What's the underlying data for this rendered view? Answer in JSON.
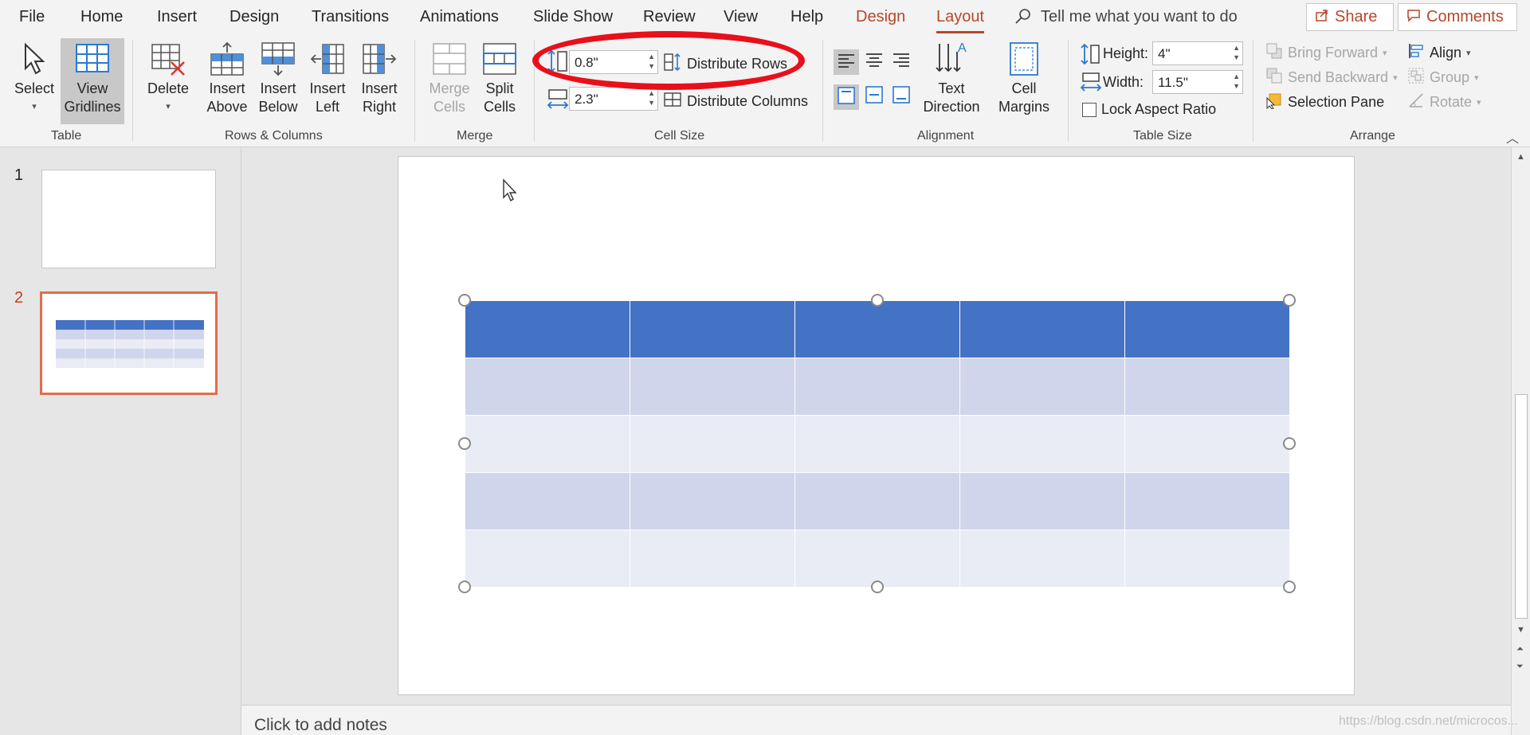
{
  "tabs": {
    "file": "File",
    "home": "Home",
    "insert": "Insert",
    "design": "Design",
    "transitions": "Transitions",
    "animations": "Animations",
    "slide_show": "Slide Show",
    "review": "Review",
    "view": "View",
    "help": "Help",
    "table_design": "Design",
    "table_layout": "Layout"
  },
  "search": {
    "label": "Tell me what you want to do"
  },
  "share": "Share",
  "comments": "Comments",
  "ribbon": {
    "table": {
      "select": "Select",
      "view_gridlines_1": "View",
      "view_gridlines_2": "Gridlines",
      "group": "Table"
    },
    "rows_cols": {
      "delete": "Delete",
      "insert_above_1": "Insert",
      "insert_above_2": "Above",
      "insert_below_1": "Insert",
      "insert_below_2": "Below",
      "insert_left_1": "Insert",
      "insert_left_2": "Left",
      "insert_right_1": "Insert",
      "insert_right_2": "Right",
      "group": "Rows & Columns"
    },
    "merge": {
      "merge_1": "Merge",
      "merge_2": "Cells",
      "split_1": "Split",
      "split_2": "Cells",
      "group": "Merge"
    },
    "cell_size": {
      "row_height": "0.8\"",
      "col_width": "2.3\"",
      "distribute_rows": "Distribute Rows",
      "distribute_columns": "Distribute Columns",
      "group": "Cell Size"
    },
    "alignment": {
      "text_dir_1": "Text",
      "text_dir_2": "Direction",
      "margins_1": "Cell",
      "margins_2": "Margins",
      "group": "Alignment"
    },
    "table_size": {
      "height_label": "Height:",
      "height_value": "4\"",
      "width_label": "Width:",
      "width_value": "11.5\"",
      "lock_aspect": "Lock Aspect Ratio",
      "group": "Table Size"
    },
    "arrange": {
      "bring_forward": "Bring Forward",
      "send_backward": "Send Backward",
      "selection_pane": "Selection Pane",
      "align": "Align",
      "group": "Group",
      "rotate": "Rotate",
      "group_label": "Arrange"
    }
  },
  "slides": [
    {
      "number": "1"
    },
    {
      "number": "2"
    }
  ],
  "notes": {
    "placeholder": "Click to add notes"
  },
  "watermark": "https://blog.csdn.net/microcos...",
  "colors": {
    "accent": "#b7472a",
    "annotation": "#e8101a",
    "table_header": "#4472c4",
    "table_band1": "#cfd5ea",
    "table_band2": "#e9ebf5"
  }
}
